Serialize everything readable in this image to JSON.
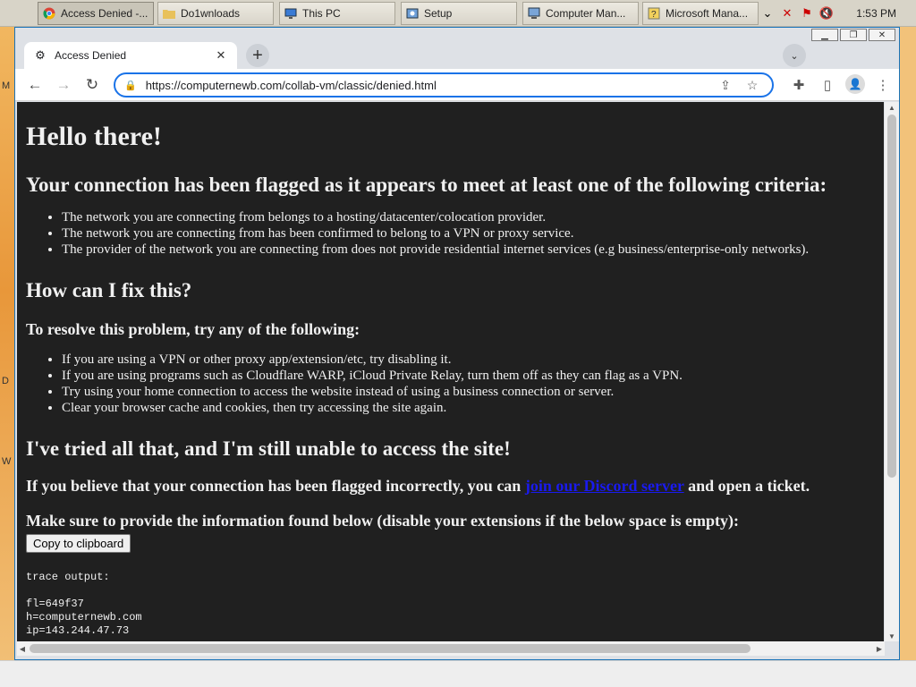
{
  "taskbar": {
    "buttons": [
      {
        "label": "Access Denied -..."
      },
      {
        "label": "Do1wnloads"
      },
      {
        "label": "This PC"
      },
      {
        "label": "Setup"
      },
      {
        "label": "Computer Man..."
      },
      {
        "label": "Microsoft Mana..."
      }
    ],
    "ghost_title": "Microsoft",
    "clock": "1:53 PM"
  },
  "browser": {
    "tab": {
      "title": "Access Denied"
    },
    "url": "https://computernewb.com/collab-vm/classic/denied.html"
  },
  "page": {
    "h1": "Hello there!",
    "h2_criteria": "Your connection has been flagged as it appears to meet at least one of the following criteria:",
    "criteria": [
      "The network you are connecting from belongs to a hosting/datacenter/colocation provider.",
      "The network you are connecting from has been confirmed to belong to a VPN or proxy service.",
      "The provider of the network you are connecting from does not provide residential internet services (e.g business/enterprise-only networks)."
    ],
    "h2_fix": "How can I fix this?",
    "h3_resolve": "To resolve this problem, try any of the following:",
    "fixes": [
      "If you are using a VPN or other proxy app/extension/etc, try disabling it.",
      "If you are using programs such as Cloudflare WARP, iCloud Private Relay, turn them off as they can flag as a VPN.",
      "Try using your home connection to access the website instead of using a business connection or server.",
      "Clear your browser cache and cookies, then try accessing the site again."
    ],
    "h2_tried": "I've tried all that, and I'm still unable to access the site!",
    "incorrect_pre": "If you believe that your connection has been flagged incorrectly, you can ",
    "discord_link": "join our Discord server",
    "incorrect_post": " and open a ticket.",
    "provide_info": "Make sure to provide the information found below (disable your extensions if the below space is empty):",
    "copy_button": "Copy to clipboard",
    "trace": "trace output:\n\nfl=649f37\nh=computernewb.com\nip=143.244.47.73"
  }
}
